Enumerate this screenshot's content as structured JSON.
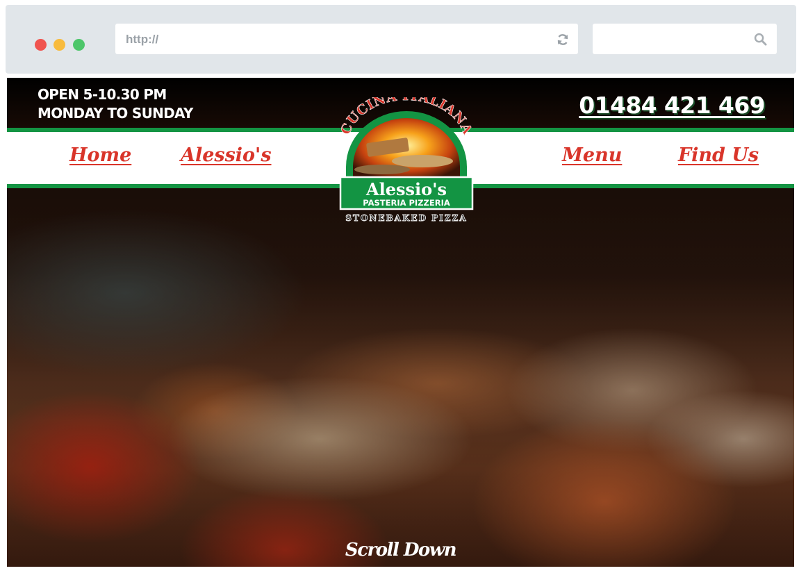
{
  "browser": {
    "url": "http://",
    "search_value": ""
  },
  "site": {
    "hours_line1": "OPEN 5-10.30 PM",
    "hours_line2": "MONDAY TO SUNDAY",
    "phone": "01484 421 469",
    "nav": {
      "left": [
        "Home",
        "Alessio's"
      ],
      "right": [
        "Menu",
        "Find Us"
      ]
    },
    "logo": {
      "arc_text": "CUCINA ITALIANA",
      "name": "Alessio's",
      "subtitle": "PASTERIA PIZZERIA",
      "tagline": "STONEBAKED PIZZA"
    },
    "scroll_label": "Scroll Down"
  },
  "colors": {
    "accent_green": "#139443",
    "accent_red": "#d9352a",
    "chrome": "#e1e6ea"
  },
  "icons": [
    "reload-icon",
    "search-icon"
  ]
}
